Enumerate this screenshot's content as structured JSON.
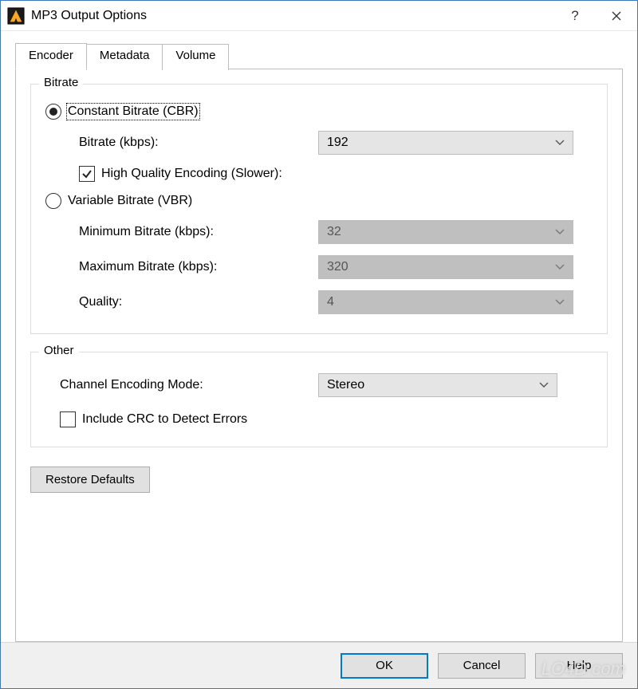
{
  "window": {
    "title": "MP3 Output Options"
  },
  "tabs": {
    "encoder": "Encoder",
    "metadata": "Metadata",
    "volume": "Volume"
  },
  "bitrate": {
    "legend": "Bitrate",
    "cbr_label": "Constant Bitrate (CBR)",
    "bitrate_label": "Bitrate (kbps):",
    "bitrate_value": "192",
    "hq_label": "High Quality Encoding (Slower):",
    "vbr_label": "Variable Bitrate (VBR)",
    "min_label": "Minimum Bitrate (kbps):",
    "min_value": "32",
    "max_label": "Maximum Bitrate (kbps):",
    "max_value": "320",
    "quality_label": "Quality:",
    "quality_value": "4"
  },
  "other": {
    "legend": "Other",
    "channel_label": "Channel Encoding Mode:",
    "channel_value": "Stereo",
    "crc_label": "Include CRC to Detect Errors"
  },
  "actions": {
    "restore": "Restore Defaults",
    "ok": "OK",
    "cancel": "Cancel",
    "help": "Help"
  },
  "watermark": "LO4D.com"
}
